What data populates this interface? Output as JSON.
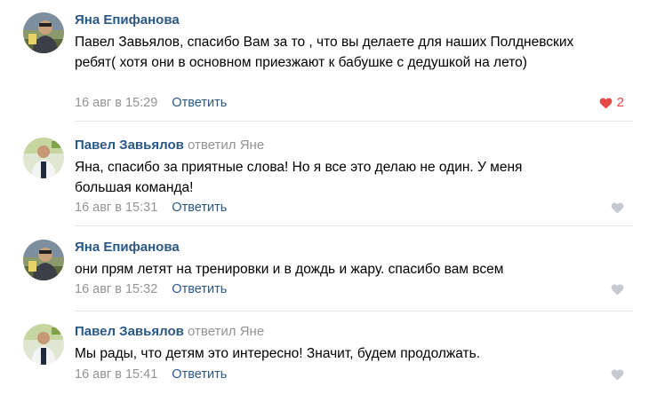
{
  "comments": [
    {
      "author": "Яна Епифанова",
      "reply_to": "",
      "text": "Павел Завьялов, спасибо Вам за то , что вы делаете для наших Полдневских ребят( хотя они в основном приезжают к бабушке с дедушкой на лето)",
      "date": "16 авг в 15:29",
      "reply_label": "Ответить",
      "likes": "2",
      "liked": true
    },
    {
      "author": "Павел Завьялов",
      "reply_to": "ответил Яне",
      "text": "Яна, спасибо за приятные слова! Но я все это делаю не один. У меня большая команда!",
      "date": "16 авг в 15:31",
      "reply_label": "Ответить",
      "likes": "",
      "liked": false
    },
    {
      "author": "Яна Епифанова",
      "reply_to": "",
      "text": "они прям летят на тренировки и в дождь и жару. спасибо вам всем",
      "date": "16 авг в 15:32",
      "reply_label": "Ответить",
      "likes": "",
      "liked": false
    },
    {
      "author": "Павел Завьялов",
      "reply_to": "ответил Яне",
      "text": "Мы рады, что детям это интересно! Значит, будем продолжать.",
      "date": "16 авг в 15:41",
      "reply_label": "Ответить",
      "likes": "",
      "liked": false
    }
  ],
  "colors": {
    "link": "#2a5885",
    "muted": "#939393",
    "like_active": "#e64646",
    "like_inactive": "#c5c9d0",
    "divider": "#e7e8ec"
  },
  "icons": {
    "like_active": "heart-filled-icon",
    "like_inactive": "heart-outline-icon"
  }
}
